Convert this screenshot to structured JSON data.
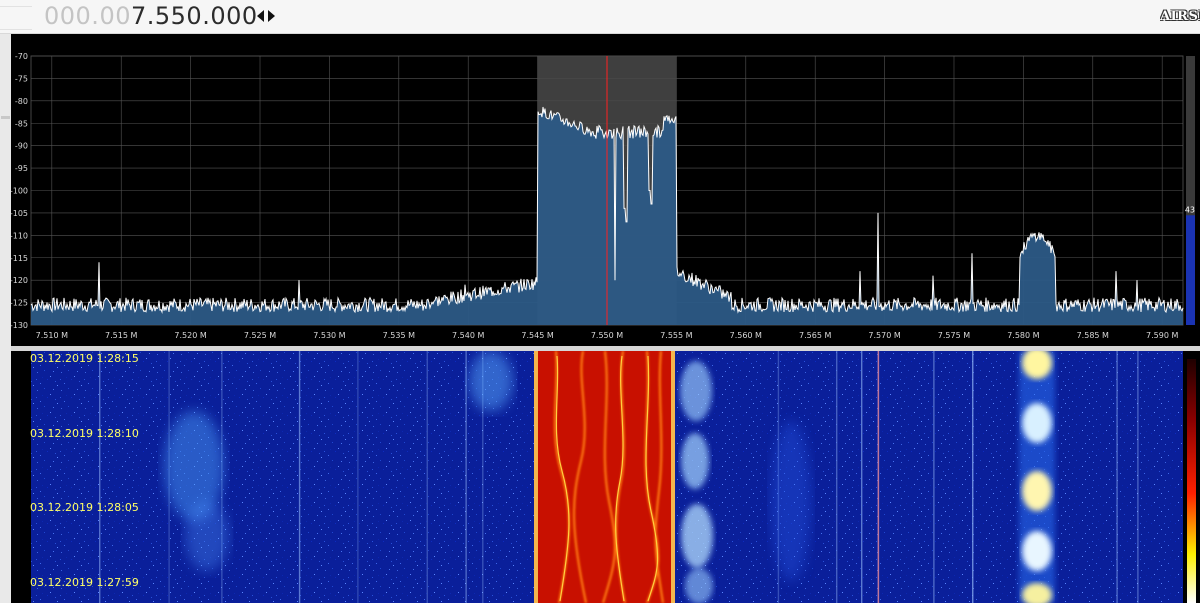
{
  "toolbar": {
    "frequency_dim": "000.00",
    "frequency_main": "7.550.000",
    "logo_text": "AIRSPY"
  },
  "spectrum": {
    "y_ticks": [
      "-70",
      "-75",
      "-80",
      "-85",
      "-90",
      "-95",
      "-100",
      "-105",
      "-110",
      "-115",
      "-120",
      "-125",
      "-130"
    ],
    "x_ticks": [
      "7.510 M",
      "7.515 M",
      "7.520 M",
      "7.525 M",
      "7.530 M",
      "7.535 M",
      "7.540 M",
      "7.545 M",
      "7.550 M",
      "7.555 M",
      "7.560 M",
      "7.565 M",
      "7.570 M",
      "7.575 M",
      "7.580 M",
      "7.585 M",
      "7.590 M"
    ],
    "gain_label": "43",
    "colors": {
      "trace": "#ffffff",
      "fill": "#2c5a86",
      "filter": "#4a4a4a",
      "center_line": "#ff2020",
      "grid": "#555555"
    }
  },
  "waterfall": {
    "timestamps": [
      "03.12.2019 1:28:15",
      "03.12.2019 1:28:10",
      "03.12.2019 1:28:05",
      "03.12.2019 1:27:59"
    ],
    "colors": {
      "background": "#0a1f9a",
      "signal_hot": "#c81000",
      "signal_peak": "#ffd020"
    }
  }
}
